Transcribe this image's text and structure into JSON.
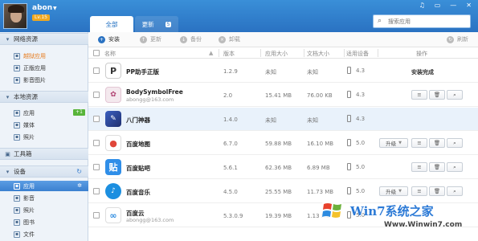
{
  "user": {
    "name": "abon",
    "level": "Lv.15"
  },
  "window_controls": [
    "♫",
    "▭",
    "—",
    "✕"
  ],
  "tabs": [
    {
      "label": "全部"
    },
    {
      "label": "更新",
      "count": "5"
    }
  ],
  "search": {
    "placeholder": "搜索应用"
  },
  "sidebar": {
    "groups": [
      {
        "label": "网络资源",
        "icon": "cloud-icon"
      },
      {
        "label": "本地资源",
        "icon": "monitor-icon"
      },
      {
        "label": "工具箱",
        "icon": "toolbox-icon"
      },
      {
        "label": "设备",
        "icon": "phone-icon"
      }
    ],
    "network_items": [
      {
        "label": "越狱应用"
      },
      {
        "label": "正版应用"
      },
      {
        "label": "影音图片"
      }
    ],
    "local_items": [
      {
        "label": "应用",
        "badge": "+1"
      },
      {
        "label": "媒体"
      },
      {
        "label": "照片"
      }
    ],
    "device_items": [
      {
        "label": "应用"
      },
      {
        "label": "影音"
      },
      {
        "label": "照片"
      },
      {
        "label": "图书"
      },
      {
        "label": "文件"
      }
    ]
  },
  "toolbar": {
    "install": "安装",
    "update": "更新",
    "backup": "备份",
    "uninstall": "卸载",
    "refresh": "刷新"
  },
  "columns": {
    "name": "名称",
    "version": "版本",
    "app_size": "应用大小",
    "doc_size": "文档大小",
    "device": "适用设备",
    "action": "操作"
  },
  "rows": [
    {
      "name": "PP助手正版",
      "subtitle": "",
      "version": "1.2.9",
      "app_size": "未知",
      "doc_size": "未知",
      "device": "4.3",
      "status": "安装完成",
      "has_upgrade": false
    },
    {
      "name": "BodySymbolFree",
      "subtitle": "abongg@163.com",
      "version": "2.0",
      "app_size": "15.41 MB",
      "doc_size": "76.00 KB",
      "device": "4.3",
      "status": "",
      "has_upgrade": false
    },
    {
      "name": "八门神器",
      "subtitle": "",
      "version": "1.4.0",
      "app_size": "未知",
      "doc_size": "未知",
      "device": "4.3",
      "status": "",
      "has_upgrade": false
    },
    {
      "name": "百度地图",
      "subtitle": "",
      "version": "6.7.0",
      "app_size": "59.88 MB",
      "doc_size": "16.10 MB",
      "device": "5.0",
      "status": "",
      "has_upgrade": true
    },
    {
      "name": "百度贴吧",
      "subtitle": "",
      "version": "5.6.1",
      "app_size": "62.36 MB",
      "doc_size": "6.89 MB",
      "device": "5.0",
      "status": "",
      "has_upgrade": false
    },
    {
      "name": "百度音乐",
      "subtitle": "",
      "version": "4.5.0",
      "app_size": "25.55 MB",
      "doc_size": "11.73 MB",
      "device": "5.0",
      "status": "",
      "has_upgrade": true
    },
    {
      "name": "百度云",
      "subtitle": "abongg@163.com",
      "version": "5.3.0.9",
      "app_size": "19.39 MB",
      "doc_size": "1.13 MB",
      "device": "5.0",
      "status": "",
      "has_upgrade": false
    }
  ],
  "upgrade_label": "升级",
  "watermark": {
    "brand": "Win7系统之家",
    "url": "Www.Winwin7.com"
  }
}
